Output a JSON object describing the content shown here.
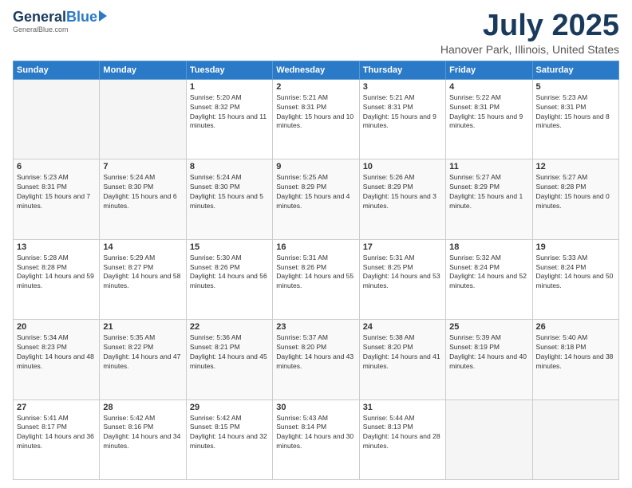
{
  "header": {
    "logo_general": "General",
    "logo_blue": "Blue",
    "logo_url": "GeneralBlue.com",
    "month_title": "July 2025",
    "location": "Hanover Park, Illinois, United States"
  },
  "days_of_week": [
    "Sunday",
    "Monday",
    "Tuesday",
    "Wednesday",
    "Thursday",
    "Friday",
    "Saturday"
  ],
  "weeks": [
    [
      {
        "day": "",
        "info": ""
      },
      {
        "day": "",
        "info": ""
      },
      {
        "day": "1",
        "info": "Sunrise: 5:20 AM\nSunset: 8:32 PM\nDaylight: 15 hours and 11 minutes."
      },
      {
        "day": "2",
        "info": "Sunrise: 5:21 AM\nSunset: 8:31 PM\nDaylight: 15 hours and 10 minutes."
      },
      {
        "day": "3",
        "info": "Sunrise: 5:21 AM\nSunset: 8:31 PM\nDaylight: 15 hours and 9 minutes."
      },
      {
        "day": "4",
        "info": "Sunrise: 5:22 AM\nSunset: 8:31 PM\nDaylight: 15 hours and 9 minutes."
      },
      {
        "day": "5",
        "info": "Sunrise: 5:23 AM\nSunset: 8:31 PM\nDaylight: 15 hours and 8 minutes."
      }
    ],
    [
      {
        "day": "6",
        "info": "Sunrise: 5:23 AM\nSunset: 8:31 PM\nDaylight: 15 hours and 7 minutes."
      },
      {
        "day": "7",
        "info": "Sunrise: 5:24 AM\nSunset: 8:30 PM\nDaylight: 15 hours and 6 minutes."
      },
      {
        "day": "8",
        "info": "Sunrise: 5:24 AM\nSunset: 8:30 PM\nDaylight: 15 hours and 5 minutes."
      },
      {
        "day": "9",
        "info": "Sunrise: 5:25 AM\nSunset: 8:29 PM\nDaylight: 15 hours and 4 minutes."
      },
      {
        "day": "10",
        "info": "Sunrise: 5:26 AM\nSunset: 8:29 PM\nDaylight: 15 hours and 3 minutes."
      },
      {
        "day": "11",
        "info": "Sunrise: 5:27 AM\nSunset: 8:29 PM\nDaylight: 15 hours and 1 minute."
      },
      {
        "day": "12",
        "info": "Sunrise: 5:27 AM\nSunset: 8:28 PM\nDaylight: 15 hours and 0 minutes."
      }
    ],
    [
      {
        "day": "13",
        "info": "Sunrise: 5:28 AM\nSunset: 8:28 PM\nDaylight: 14 hours and 59 minutes."
      },
      {
        "day": "14",
        "info": "Sunrise: 5:29 AM\nSunset: 8:27 PM\nDaylight: 14 hours and 58 minutes."
      },
      {
        "day": "15",
        "info": "Sunrise: 5:30 AM\nSunset: 8:26 PM\nDaylight: 14 hours and 56 minutes."
      },
      {
        "day": "16",
        "info": "Sunrise: 5:31 AM\nSunset: 8:26 PM\nDaylight: 14 hours and 55 minutes."
      },
      {
        "day": "17",
        "info": "Sunrise: 5:31 AM\nSunset: 8:25 PM\nDaylight: 14 hours and 53 minutes."
      },
      {
        "day": "18",
        "info": "Sunrise: 5:32 AM\nSunset: 8:24 PM\nDaylight: 14 hours and 52 minutes."
      },
      {
        "day": "19",
        "info": "Sunrise: 5:33 AM\nSunset: 8:24 PM\nDaylight: 14 hours and 50 minutes."
      }
    ],
    [
      {
        "day": "20",
        "info": "Sunrise: 5:34 AM\nSunset: 8:23 PM\nDaylight: 14 hours and 48 minutes."
      },
      {
        "day": "21",
        "info": "Sunrise: 5:35 AM\nSunset: 8:22 PM\nDaylight: 14 hours and 47 minutes."
      },
      {
        "day": "22",
        "info": "Sunrise: 5:36 AM\nSunset: 8:21 PM\nDaylight: 14 hours and 45 minutes."
      },
      {
        "day": "23",
        "info": "Sunrise: 5:37 AM\nSunset: 8:20 PM\nDaylight: 14 hours and 43 minutes."
      },
      {
        "day": "24",
        "info": "Sunrise: 5:38 AM\nSunset: 8:20 PM\nDaylight: 14 hours and 41 minutes."
      },
      {
        "day": "25",
        "info": "Sunrise: 5:39 AM\nSunset: 8:19 PM\nDaylight: 14 hours and 40 minutes."
      },
      {
        "day": "26",
        "info": "Sunrise: 5:40 AM\nSunset: 8:18 PM\nDaylight: 14 hours and 38 minutes."
      }
    ],
    [
      {
        "day": "27",
        "info": "Sunrise: 5:41 AM\nSunset: 8:17 PM\nDaylight: 14 hours and 36 minutes."
      },
      {
        "day": "28",
        "info": "Sunrise: 5:42 AM\nSunset: 8:16 PM\nDaylight: 14 hours and 34 minutes."
      },
      {
        "day": "29",
        "info": "Sunrise: 5:42 AM\nSunset: 8:15 PM\nDaylight: 14 hours and 32 minutes."
      },
      {
        "day": "30",
        "info": "Sunrise: 5:43 AM\nSunset: 8:14 PM\nDaylight: 14 hours and 30 minutes."
      },
      {
        "day": "31",
        "info": "Sunrise: 5:44 AM\nSunset: 8:13 PM\nDaylight: 14 hours and 28 minutes."
      },
      {
        "day": "",
        "info": ""
      },
      {
        "day": "",
        "info": ""
      }
    ]
  ]
}
